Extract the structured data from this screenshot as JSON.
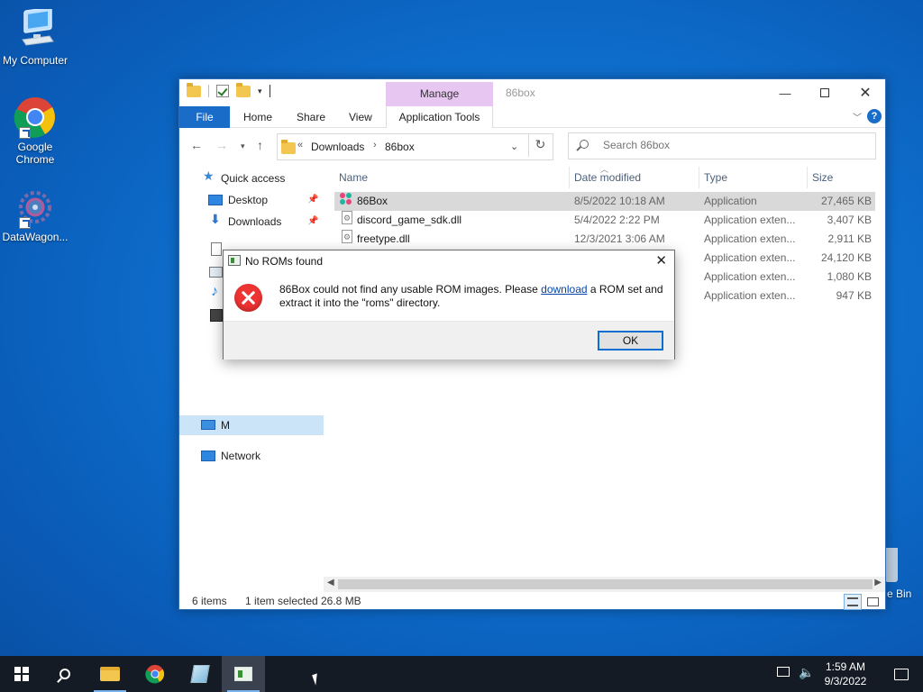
{
  "desktop": {
    "icons": [
      {
        "label": "My Computer"
      },
      {
        "label": "Google Chrome"
      },
      {
        "label": "DataWagon..."
      }
    ],
    "recycle_label_fragment": "e Bin"
  },
  "explorer": {
    "title": "86box",
    "manage_tab": "Manage",
    "ribbon_tabs": [
      "File",
      "Home",
      "Share",
      "View",
      "Application Tools"
    ],
    "address": {
      "prefix": "«",
      "crumbs": [
        "Downloads",
        "86box"
      ]
    },
    "search_placeholder": "Search 86box",
    "nav": {
      "quick_access": "Quick access",
      "desktop": "Desktop",
      "downloads": "Downloads",
      "network": "Network",
      "this_pc_initial": "M"
    },
    "columns": [
      "Name",
      "Date modified",
      "Type",
      "Size"
    ],
    "files": [
      {
        "name": "86Box",
        "date": "8/5/2022 10:18 AM",
        "type": "Application",
        "size": "27,465 KB"
      },
      {
        "name": "discord_game_sdk.dll",
        "date": "5/4/2022 2:22 PM",
        "type": "Application exten...",
        "size": "3,407 KB"
      },
      {
        "name": "freetype.dll",
        "date": "12/3/2021 3:06 AM",
        "type": "Application exten...",
        "size": "2,911 KB"
      },
      {
        "name": "",
        "date": "",
        "type": "Application exten...",
        "size": "24,120 KB"
      },
      {
        "name": "",
        "date": "",
        "type": "Application exten...",
        "size": "1,080 KB"
      },
      {
        "name": "",
        "date": "",
        "type": "Application exten...",
        "size": "947 KB"
      }
    ],
    "status": {
      "items": "6 items",
      "selected": "1 item selected",
      "size": "26.8 MB"
    }
  },
  "dialog": {
    "title": "No ROMs found",
    "message_part1": "86Box could not find any usable ROM images. Please ",
    "link_text": "download",
    "message_part2": " a ROM set and extract it into the \"roms\" directory.",
    "ok_label": "OK"
  },
  "taskbar": {
    "time": "1:59 AM",
    "date": "9/3/2022"
  },
  "colors": {
    "accent": "#1a6cc9",
    "manage_tab": "#e8c6f2",
    "error_red": "#e33333",
    "taskbar": "#141b24"
  }
}
